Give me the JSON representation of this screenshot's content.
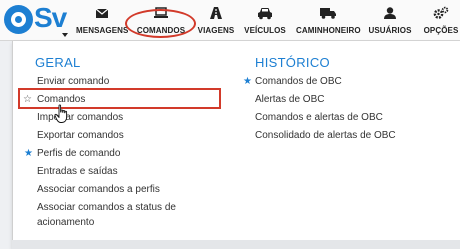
{
  "logo": {
    "text": "Sv"
  },
  "nav": [
    {
      "label": "MENSAGENS",
      "icon": "envelope-icon"
    },
    {
      "label": "COMANDOS",
      "icon": "laptop-icon"
    },
    {
      "label": "VIAGENS",
      "icon": "road-icon"
    },
    {
      "label": "VEÍCULOS",
      "icon": "car-icon"
    },
    {
      "label": "CAMINHONEIRO",
      "icon": "truck-icon"
    },
    {
      "label": "USUÁRIOS",
      "icon": "user-icon"
    },
    {
      "label": "OPÇÕES",
      "icon": "gears-icon"
    }
  ],
  "dropdown": {
    "geral": {
      "title": "GERAL",
      "items": [
        {
          "label": "Enviar comando",
          "starred": false
        },
        {
          "label": "Comandos",
          "starred": false,
          "outlined_star": true
        },
        {
          "label": "Importar comandos",
          "starred": false
        },
        {
          "label": "Exportar comandos",
          "starred": false
        },
        {
          "label": "Perfis de comando",
          "starred": true
        },
        {
          "label": "Entradas e saídas",
          "starred": false
        },
        {
          "label": "Associar comandos a perfis",
          "starred": false
        },
        {
          "label": "Associar comandos a status de",
          "starred": false
        },
        {
          "label": "acionamento",
          "starred": false
        }
      ]
    },
    "historico": {
      "title": "HISTÓRICO",
      "items": [
        {
          "label": "Comandos de OBC",
          "starred": true
        },
        {
          "label": "Alertas de OBC",
          "starred": false
        },
        {
          "label": "Comandos e alertas de OBC",
          "starred": false
        },
        {
          "label": "Consolidado de alertas de OBC",
          "starred": false
        }
      ]
    }
  },
  "colors": {
    "accent": "#1d7fd2",
    "highlight": "#d23a2a",
    "text": "#333333"
  }
}
